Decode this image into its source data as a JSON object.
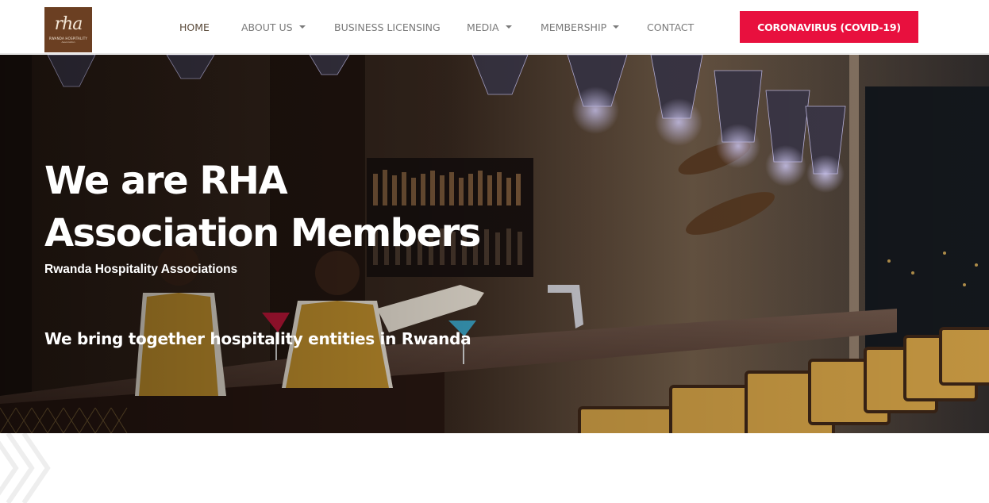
{
  "brand": {
    "logo_mark": "rha",
    "logo_text": "Rwanda Hospitality",
    "logo_sub": "Association"
  },
  "nav": {
    "items": [
      {
        "label": "HOME",
        "dropdown": false,
        "active": true
      },
      {
        "label": "ABOUT US",
        "dropdown": true,
        "active": false
      },
      {
        "label": "BUSINESS LICENSING",
        "dropdown": false,
        "active": false
      },
      {
        "label": "MEDIA",
        "dropdown": true,
        "active": false
      },
      {
        "label": "MEMBERSHIP",
        "dropdown": true,
        "active": false
      },
      {
        "label": "CONTACT",
        "dropdown": false,
        "active": false
      }
    ],
    "cta_label": "CORONAVIRUS (COVID-19)"
  },
  "hero": {
    "title_line1": "We are RHA",
    "title_line2": "Association Members",
    "subtitle": "Rwanda Hospitality Associations",
    "tagline": "We bring together hospitality entities in Rwanda"
  },
  "colors": {
    "brand_brown": "#6b3f22",
    "cta_red": "#e8103e",
    "nav_text": "#7a7a7a",
    "nav_active": "#5a4a3a"
  },
  "icons": {
    "dropdown": "chevron-down-icon"
  }
}
